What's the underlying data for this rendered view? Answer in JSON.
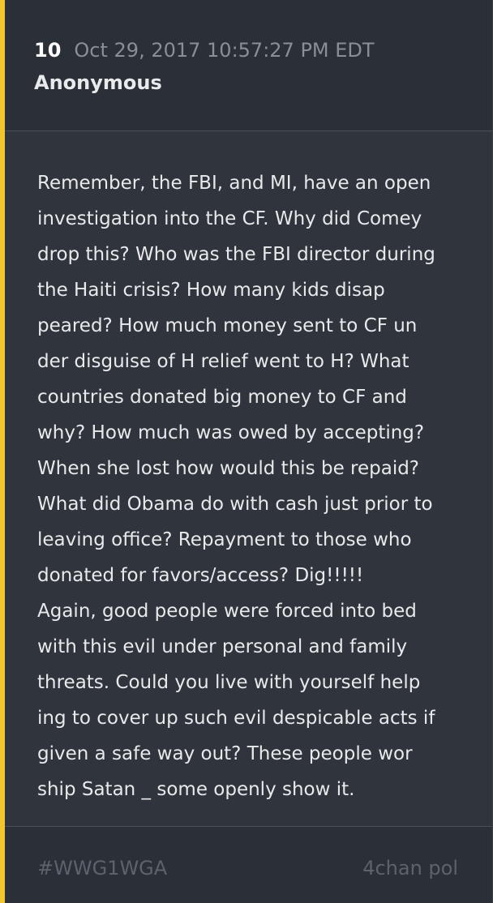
{
  "post": {
    "number": "10",
    "timestamp": "Oct 29, 2017 10:57:27 PM EDT",
    "author": "Anonymous",
    "body_lines": [
      "Remember, the FBI, and MI, have an open",
      "investigation into the CF. Why did Comey",
      "drop this? Who was the FBI director during",
      "the Haiti crisis? How many kids disap",
      "peared? How much money sent to CF un",
      "der disguise of H relief went to H? What",
      "countries donated big money to CF and",
      "why? How much was owed by accepting?",
      "When she lost how would this be repaid?",
      "What did Obama do with cash just prior to",
      "leaving office? Repayment to those who",
      "donated for favors/access? Dig!!!!!",
      "Again, good people were forced into bed",
      "with this evil under personal and family",
      "threats. Could you live with yourself help",
      "ing to cover up such evil despicable acts if",
      "given a safe way out? These people wor",
      "ship Satan _ some openly show it."
    ]
  },
  "footer": {
    "hashtag": "#WWG1WGA",
    "source": "4chan pol"
  },
  "colors": {
    "accent_bar": "#f2c52e",
    "background": "#30343c",
    "text": "#e8e9eb",
    "muted": "#8a8f97"
  }
}
